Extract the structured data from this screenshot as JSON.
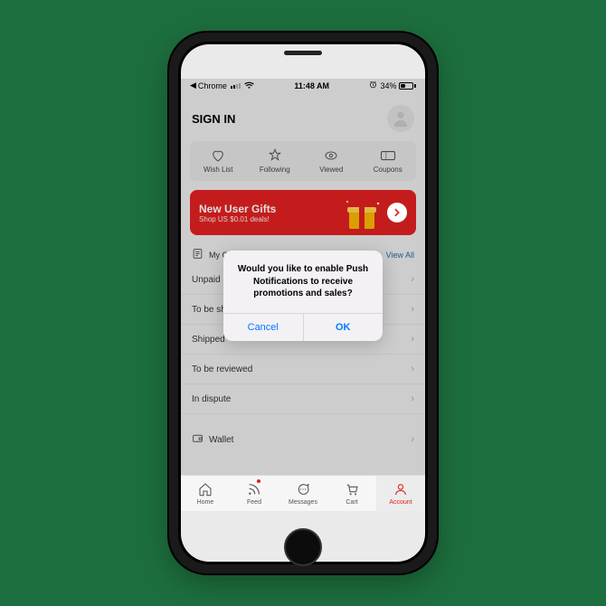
{
  "status_bar": {
    "back_app": "Chrome",
    "time": "11:48 AM",
    "battery_pct": "34%"
  },
  "header": {
    "title": "SIGN IN"
  },
  "quick": {
    "wishlist": "Wish List",
    "following": "Following",
    "viewed": "Viewed",
    "coupons": "Coupons"
  },
  "banner": {
    "title": "New User Gifts",
    "sub": "Shop US $0.01 deals!"
  },
  "orders": {
    "header": "My Orders",
    "view_all": "View All",
    "items": [
      "Unpaid",
      "To be shipped",
      "Shipped",
      "To be reviewed",
      "In dispute"
    ]
  },
  "wallet": {
    "label": "Wallet"
  },
  "tabs": {
    "home": "Home",
    "feed": "Feed",
    "messages": "Messages",
    "cart": "Cart",
    "account": "Account"
  },
  "dialog": {
    "message": "Would you like to enable Push Notifications to receive promotions and sales?",
    "cancel": "Cancel",
    "ok": "OK"
  }
}
